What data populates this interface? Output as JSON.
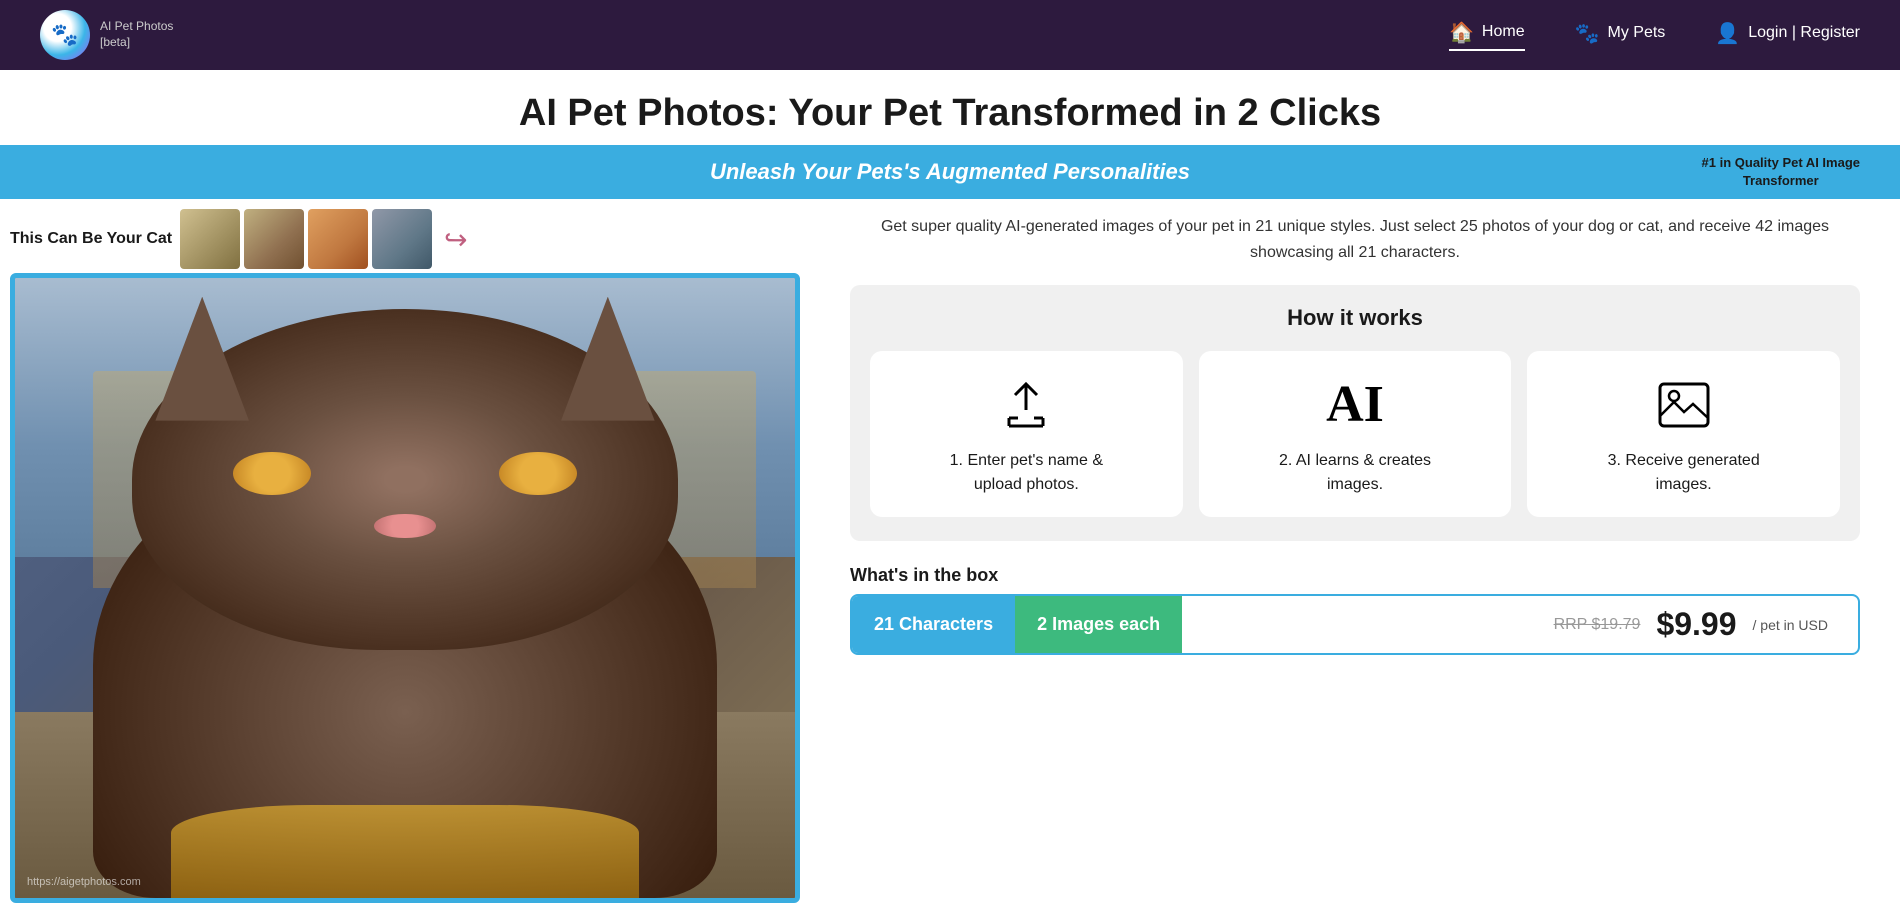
{
  "header": {
    "logo_text": "AI Pet Photos",
    "logo_beta": "[beta]",
    "logo_icon": "🐾",
    "nav_items": [
      {
        "label": "Home",
        "icon": "🏠",
        "active": true
      },
      {
        "label": "My Pets",
        "icon": "🐾",
        "active": false
      },
      {
        "label": "Login | Register",
        "icon": "👤",
        "active": false
      }
    ]
  },
  "page_title": "AI Pet Photos: Your Pet Transformed in 2 Clicks",
  "banner": {
    "text": "Unleash Your Pets's Augmented Personalities",
    "badge_line1": "#1 in Quality Pet AI Image",
    "badge_line2": "Transformer"
  },
  "left_panel": {
    "this_can_label": "This Can Be Your Cat",
    "url_watermark": "https://aigetphotos.com",
    "arrow_symbol": "↩"
  },
  "right_panel": {
    "description": "Get super quality AI-generated images of your pet in 21 unique styles. Just select 25 photos of your dog or cat, and receive 42 images showcasing all 21 characters.",
    "how_it_works_title": "How it works",
    "steps": [
      {
        "icon_type": "upload",
        "label": "1. Enter pet's name &\nupload photos."
      },
      {
        "icon_type": "ai",
        "label": "2. AI learns & creates\nimages."
      },
      {
        "icon_type": "image",
        "label": "3. Receive generated\nimages."
      }
    ],
    "whats_in_box_label": "What's in the box",
    "whats_in_box": {
      "tag1": "21 Characters",
      "tag2": "2 Images each",
      "rrp_label": "RRP $19.79",
      "price": "$9.99",
      "per_label": "/ pet in USD"
    }
  }
}
